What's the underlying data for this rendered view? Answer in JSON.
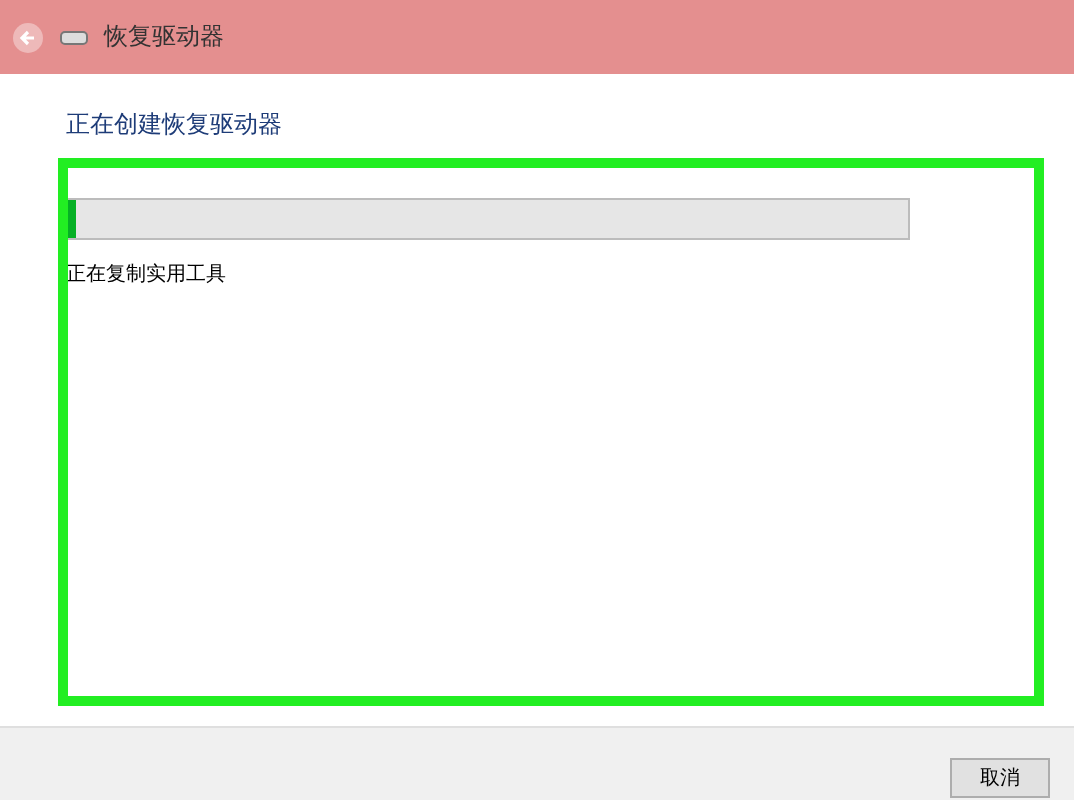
{
  "window": {
    "title": "恢复驱动器"
  },
  "heading": "正在创建恢复驱动器",
  "progress": {
    "level": 0.01
  },
  "status": "正在复制实用工具",
  "highlight": {
    "kind": "frame"
  },
  "buttons": [
    "取消"
  ]
}
